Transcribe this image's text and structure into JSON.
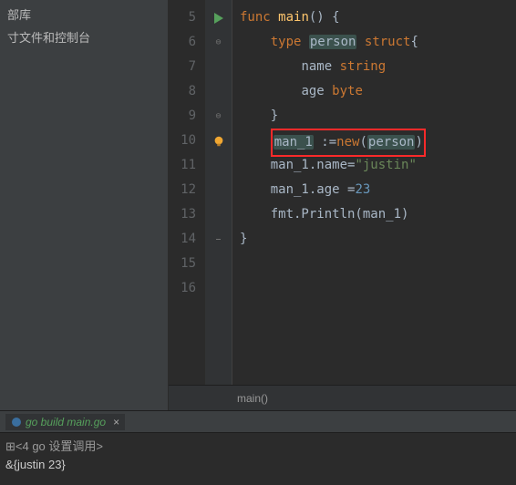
{
  "sidebar": {
    "items": [
      "部库",
      "寸文件和控制台"
    ]
  },
  "editor": {
    "line_numbers": [
      "5",
      "6",
      "7",
      "8",
      "9",
      "10",
      "11",
      "12",
      "13",
      "14",
      "15",
      "16"
    ],
    "code": {
      "l5": {
        "kw1": "func ",
        "fn": "main",
        "t1": "() {"
      },
      "l6": {
        "pad": "    ",
        "kw": "type ",
        "id": "person",
        "t1": " ",
        "kw2": "struct",
        "t2": "{"
      },
      "l7": {
        "pad": "        ",
        "id": "name ",
        "typ": "string"
      },
      "l8": {
        "pad": "        ",
        "id": "age ",
        "typ": "byte"
      },
      "l9": {
        "pad": "    ",
        "t": "}"
      },
      "l10": {
        "pad": "    ",
        "id": "man_1",
        "t1": " :=",
        "kw": "new",
        "p": "(",
        "cls": "person",
        "cp": ")"
      },
      "l11": {
        "pad": "    ",
        "t1": "man_1.name=",
        "s": "\"justin\""
      },
      "l12": {
        "pad": "    ",
        "t1": "man_1.age =",
        "n": "23"
      },
      "l13": {
        "pad": "    ",
        "t1": "fmt.Println(man_1)"
      },
      "l14": {
        "t": "}"
      }
    }
  },
  "breadcrumb": {
    "text": "main()"
  },
  "run_tab": {
    "label": "go build main.go",
    "close": "×"
  },
  "console": {
    "prompt": "⊞<4 go 设置调用>",
    "output": "&{justin 23}"
  }
}
